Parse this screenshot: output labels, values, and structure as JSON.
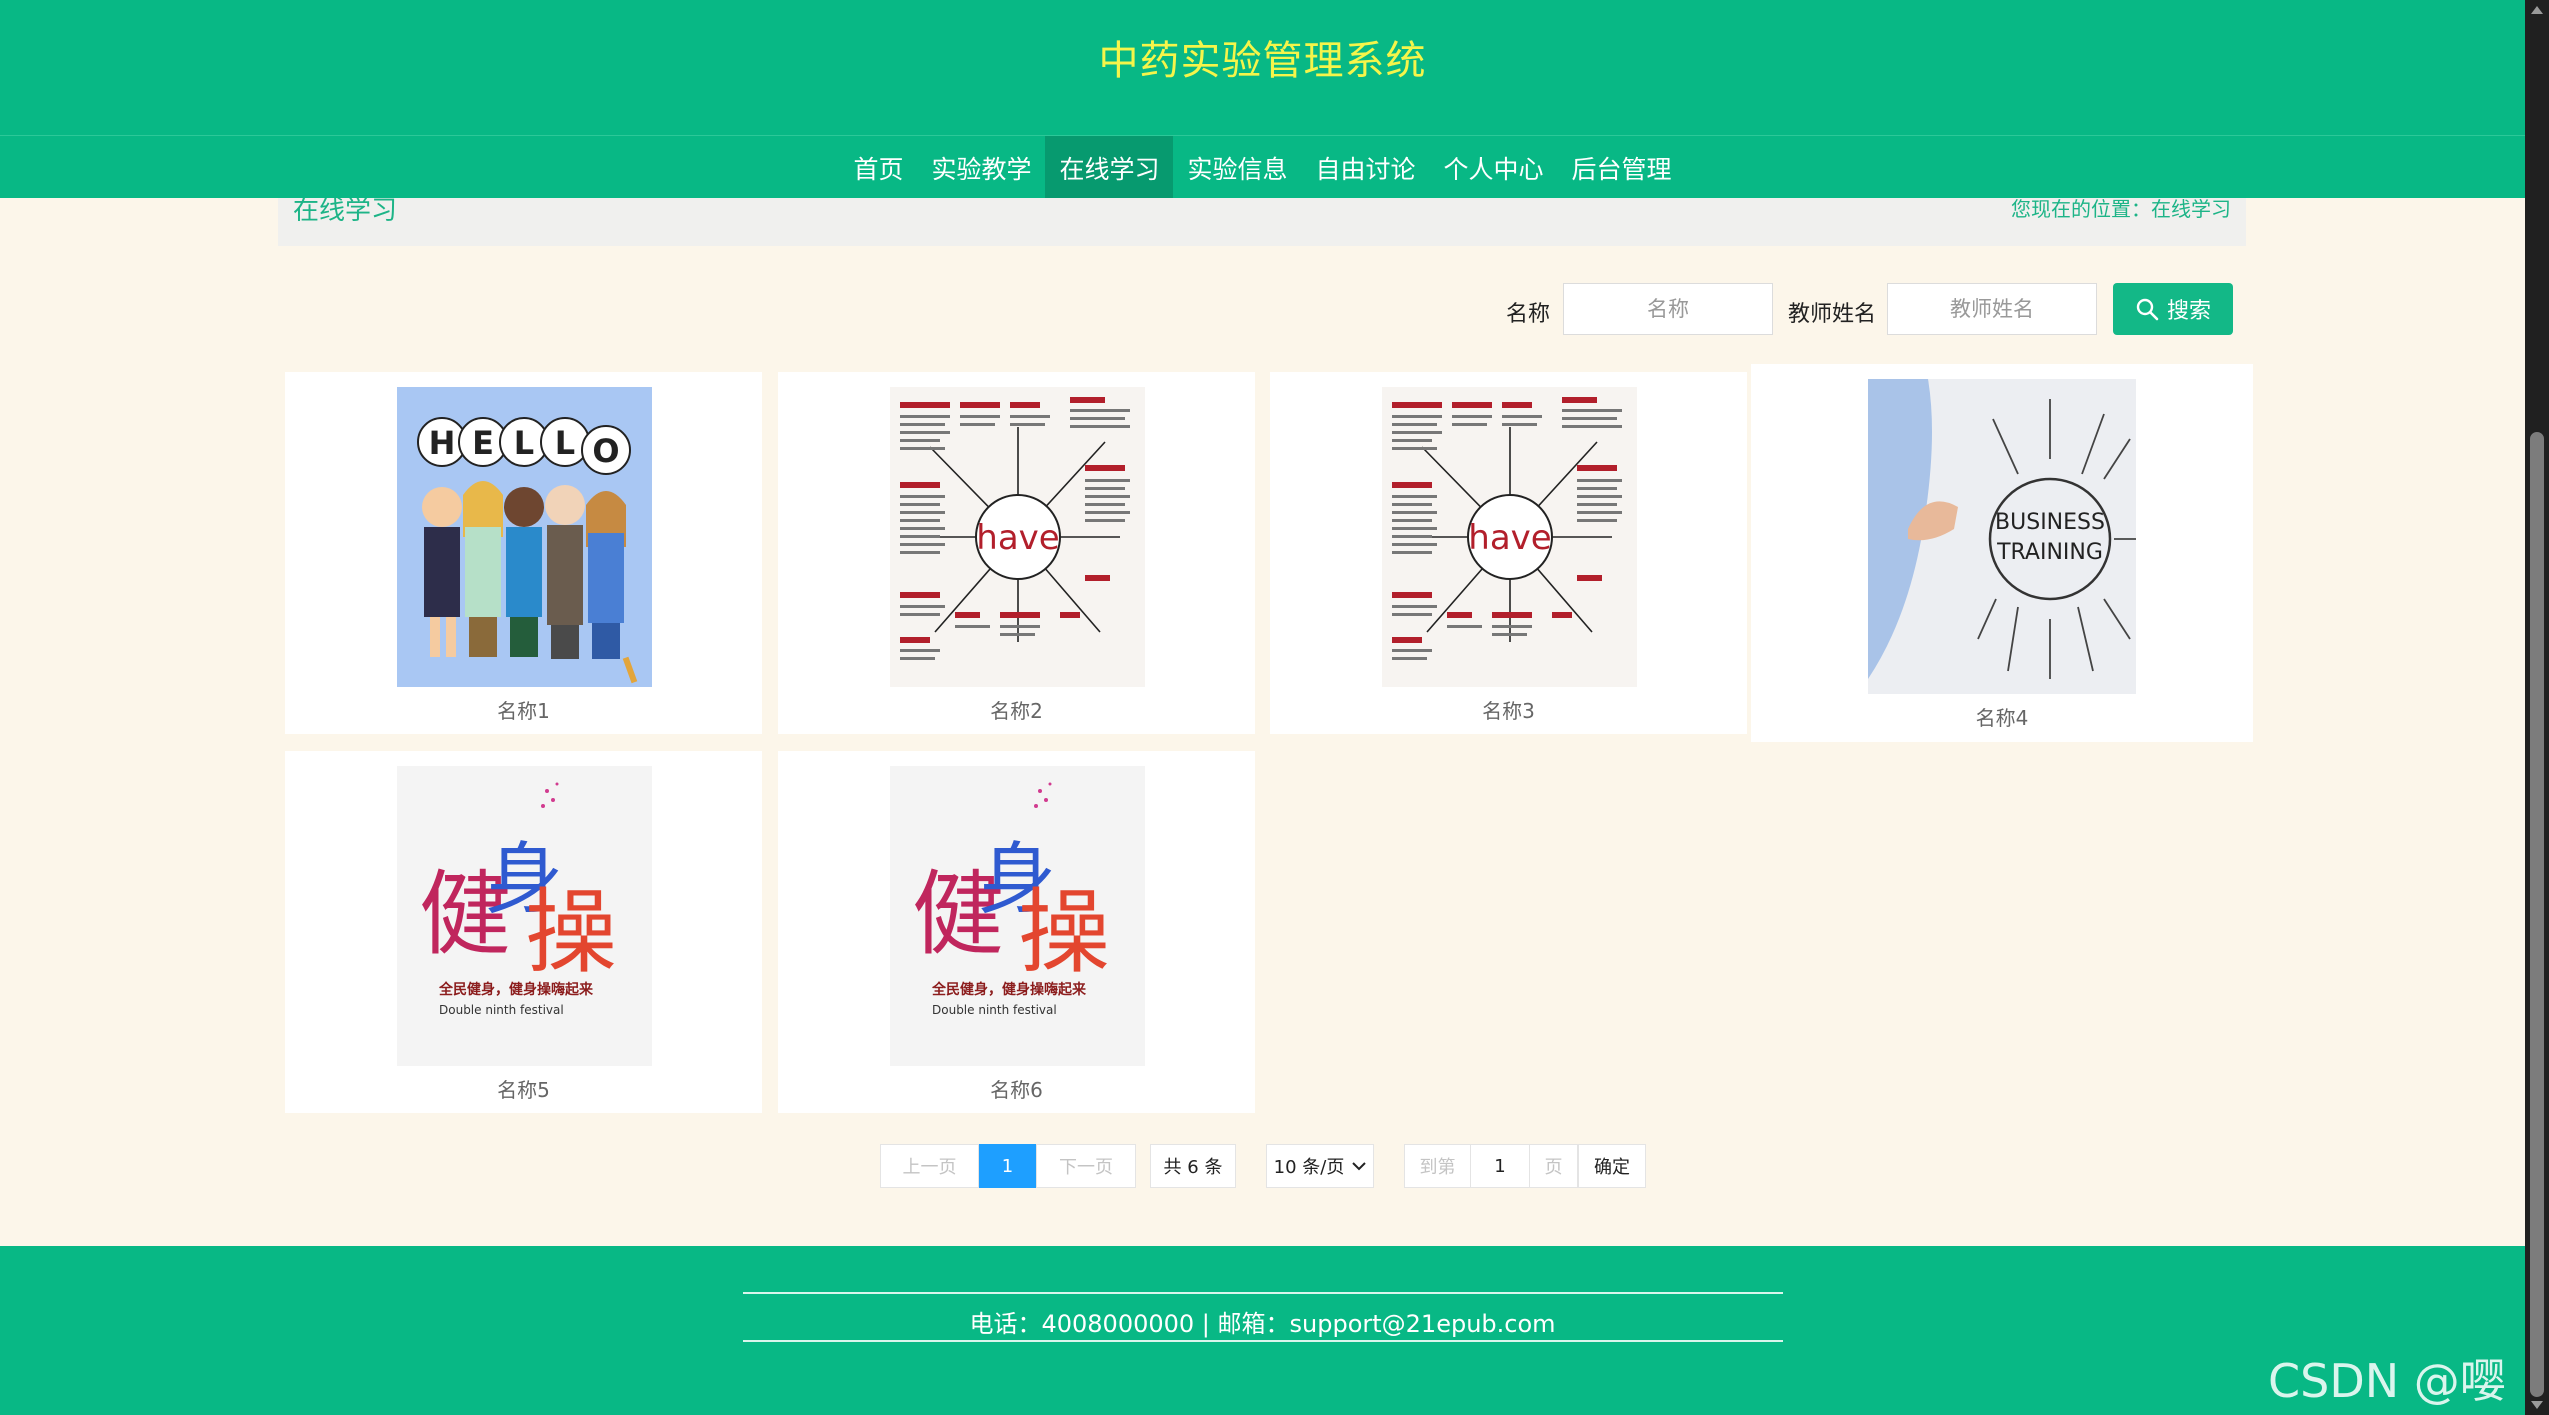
{
  "header": {
    "title": "中药实验管理系统"
  },
  "nav": {
    "items": [
      "首页",
      "实验教学",
      "在线学习",
      "实验信息",
      "自由讨论",
      "个人中心",
      "后台管理"
    ],
    "active": "在线学习"
  },
  "breadcrumb": {
    "title": "在线学习",
    "location": "您现在的位置：在线学习"
  },
  "search": {
    "name_label": "名称",
    "name_placeholder": "名称",
    "teacher_label": "教师姓名",
    "teacher_placeholder": "教师姓名",
    "button_label": "搜索",
    "button_icon": "search-icon"
  },
  "cards": [
    {
      "label": "名称1",
      "image": "hello-cartoon"
    },
    {
      "label": "名称2",
      "image": "have-mindmap"
    },
    {
      "label": "名称3",
      "image": "have-mindmap"
    },
    {
      "label": "名称4",
      "image": "business-training"
    },
    {
      "label": "名称5",
      "image": "jiancao-calligraphy"
    },
    {
      "label": "名称6",
      "image": "jiancao-calligraphy"
    }
  ],
  "images": {
    "hello_letters": [
      "H",
      "E",
      "L",
      "L",
      "O"
    ],
    "have_word": "have",
    "business": [
      "BUSINESS",
      "TRAINING"
    ],
    "jiancao_chars": "健身操",
    "jiancao_sub1": "全民健身，健身操嗨起来",
    "jiancao_sub2": "Double ninth festival"
  },
  "pagination": {
    "prev": "上一页",
    "current": "1",
    "next": "下一页",
    "total": "共 6 条",
    "page_size": "10 条/页",
    "page_size_options": [
      "10 条/页"
    ],
    "goto_prefix": "到第",
    "goto_value": "1",
    "goto_suffix": "页",
    "confirm": "确定"
  },
  "footer": {
    "text": "电话：4008000000 | 邮箱：support@21epub.com"
  },
  "watermark": "CSDN @嘤er",
  "colors": {
    "primary": "#08b885",
    "title": "#f5f54a",
    "active_page": "#1e9fff",
    "background": "#fcf6ea"
  }
}
